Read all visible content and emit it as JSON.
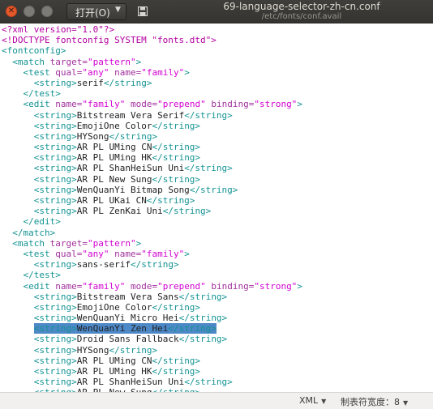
{
  "window": {
    "title": "69-language-selector-zh-cn.conf",
    "subtitle": "/etc/fonts/conf.avail",
    "open_label": "打开(O)",
    "close_icon": "close-icon",
    "minimize_icon": "minimize-icon",
    "maximize_icon": "maximize-icon",
    "save_icon": "save-icon"
  },
  "colors": {
    "tag": "#159393",
    "attr_name": "#a0309c",
    "attr_value": "#d100d1",
    "selection": "#4d88c7",
    "close_button": "#e5592b"
  },
  "editor": {
    "selected_line": 28,
    "lines": [
      [
        [
          "pi",
          "<?xml version=\"1.0\"?>"
        ]
      ],
      [
        [
          "pi",
          "<!DOCTYPE fontconfig SYSTEM \"fonts.dtd\">"
        ]
      ],
      [
        [
          "t",
          "<fontconfig>"
        ]
      ],
      [
        [
          "p",
          "  "
        ],
        [
          "t",
          "<match "
        ],
        [
          "a",
          "target="
        ],
        [
          "v",
          "\"pattern\""
        ],
        [
          "t",
          ">"
        ]
      ],
      [
        [
          "p",
          "    "
        ],
        [
          "t",
          "<test "
        ],
        [
          "a",
          "qual="
        ],
        [
          "v",
          "\"any\""
        ],
        [
          "p",
          " "
        ],
        [
          "a",
          "name="
        ],
        [
          "v",
          "\"family\""
        ],
        [
          "t",
          ">"
        ]
      ],
      [
        [
          "p",
          "      "
        ],
        [
          "t",
          "<string>"
        ],
        [
          "p",
          "serif"
        ],
        [
          "t",
          "</string>"
        ]
      ],
      [
        [
          "p",
          "    "
        ],
        [
          "t",
          "</test>"
        ]
      ],
      [
        [
          "p",
          "    "
        ],
        [
          "t",
          "<edit "
        ],
        [
          "a",
          "name="
        ],
        [
          "v",
          "\"family\""
        ],
        [
          "p",
          " "
        ],
        [
          "a",
          "mode="
        ],
        [
          "v",
          "\"prepend\""
        ],
        [
          "p",
          " "
        ],
        [
          "a",
          "binding="
        ],
        [
          "v",
          "\"strong\""
        ],
        [
          "t",
          ">"
        ]
      ],
      [
        [
          "p",
          "      "
        ],
        [
          "t",
          "<string>"
        ],
        [
          "p",
          "Bitstream Vera Serif"
        ],
        [
          "t",
          "</string>"
        ]
      ],
      [
        [
          "p",
          "      "
        ],
        [
          "t",
          "<string>"
        ],
        [
          "p",
          "EmojiOne Color"
        ],
        [
          "t",
          "</string>"
        ]
      ],
      [
        [
          "p",
          "      "
        ],
        [
          "t",
          "<string>"
        ],
        [
          "p",
          "HYSong"
        ],
        [
          "t",
          "</string>"
        ]
      ],
      [
        [
          "p",
          "      "
        ],
        [
          "t",
          "<string>"
        ],
        [
          "p",
          "AR PL UMing CN"
        ],
        [
          "t",
          "</string>"
        ]
      ],
      [
        [
          "p",
          "      "
        ],
        [
          "t",
          "<string>"
        ],
        [
          "p",
          "AR PL UMing HK"
        ],
        [
          "t",
          "</string>"
        ]
      ],
      [
        [
          "p",
          "      "
        ],
        [
          "t",
          "<string>"
        ],
        [
          "p",
          "AR PL ShanHeiSun Uni"
        ],
        [
          "t",
          "</string>"
        ]
      ],
      [
        [
          "p",
          "      "
        ],
        [
          "t",
          "<string>"
        ],
        [
          "p",
          "AR PL New Sung"
        ],
        [
          "t",
          "</string>"
        ]
      ],
      [
        [
          "p",
          "      "
        ],
        [
          "t",
          "<string>"
        ],
        [
          "p",
          "WenQuanYi Bitmap Song"
        ],
        [
          "t",
          "</string>"
        ]
      ],
      [
        [
          "p",
          "      "
        ],
        [
          "t",
          "<string>"
        ],
        [
          "p",
          "AR PL UKai CN"
        ],
        [
          "t",
          "</string>"
        ]
      ],
      [
        [
          "p",
          "      "
        ],
        [
          "t",
          "<string>"
        ],
        [
          "p",
          "AR PL ZenKai Uni"
        ],
        [
          "t",
          "</string>"
        ]
      ],
      [
        [
          "p",
          "    "
        ],
        [
          "t",
          "</edit>"
        ]
      ],
      [
        [
          "p",
          "  "
        ],
        [
          "t",
          "</match>"
        ]
      ],
      [
        [
          "p",
          "  "
        ],
        [
          "t",
          "<match "
        ],
        [
          "a",
          "target="
        ],
        [
          "v",
          "\"pattern\""
        ],
        [
          "t",
          ">"
        ]
      ],
      [
        [
          "p",
          "    "
        ],
        [
          "t",
          "<test "
        ],
        [
          "a",
          "qual="
        ],
        [
          "v",
          "\"any\""
        ],
        [
          "p",
          " "
        ],
        [
          "a",
          "name="
        ],
        [
          "v",
          "\"family\""
        ],
        [
          "t",
          ">"
        ]
      ],
      [
        [
          "p",
          "      "
        ],
        [
          "t",
          "<string>"
        ],
        [
          "p",
          "sans-serif"
        ],
        [
          "t",
          "</string>"
        ]
      ],
      [
        [
          "p",
          "    "
        ],
        [
          "t",
          "</test>"
        ]
      ],
      [
        [
          "p",
          "    "
        ],
        [
          "t",
          "<edit "
        ],
        [
          "a",
          "name="
        ],
        [
          "v",
          "\"family\""
        ],
        [
          "p",
          " "
        ],
        [
          "a",
          "mode="
        ],
        [
          "v",
          "\"prepend\""
        ],
        [
          "p",
          " "
        ],
        [
          "a",
          "binding="
        ],
        [
          "v",
          "\"strong\""
        ],
        [
          "t",
          ">"
        ]
      ],
      [
        [
          "p",
          "      "
        ],
        [
          "t",
          "<string>"
        ],
        [
          "p",
          "Bitstream Vera Sans"
        ],
        [
          "t",
          "</string>"
        ]
      ],
      [
        [
          "p",
          "      "
        ],
        [
          "t",
          "<string>"
        ],
        [
          "p",
          "EmojiOne Color"
        ],
        [
          "t",
          "</string>"
        ]
      ],
      [
        [
          "p",
          "      "
        ],
        [
          "t",
          "<string>"
        ],
        [
          "p",
          "WenQuanYi Micro Hei"
        ],
        [
          "t",
          "</string>"
        ]
      ],
      [
        [
          "p",
          "      "
        ],
        [
          "t",
          "<string>"
        ],
        [
          "p",
          "WenQuanYi Zen Hei"
        ],
        [
          "t",
          "</string>"
        ]
      ],
      [
        [
          "p",
          "      "
        ],
        [
          "t",
          "<string>"
        ],
        [
          "p",
          "Droid Sans Fallback"
        ],
        [
          "t",
          "</string>"
        ]
      ],
      [
        [
          "p",
          "      "
        ],
        [
          "t",
          "<string>"
        ],
        [
          "p",
          "HYSong"
        ],
        [
          "t",
          "</string>"
        ]
      ],
      [
        [
          "p",
          "      "
        ],
        [
          "t",
          "<string>"
        ],
        [
          "p",
          "AR PL UMing CN"
        ],
        [
          "t",
          "</string>"
        ]
      ],
      [
        [
          "p",
          "      "
        ],
        [
          "t",
          "<string>"
        ],
        [
          "p",
          "AR PL UMing HK"
        ],
        [
          "t",
          "</string>"
        ]
      ],
      [
        [
          "p",
          "      "
        ],
        [
          "t",
          "<string>"
        ],
        [
          "p",
          "AR PL ShanHeiSun Uni"
        ],
        [
          "t",
          "</string>"
        ]
      ],
      [
        [
          "p",
          "      "
        ],
        [
          "t",
          "<string>"
        ],
        [
          "p",
          "AR PL New Sung"
        ],
        [
          "t",
          "</string>"
        ]
      ]
    ]
  },
  "statusbar": {
    "language": "XML",
    "tab_width": "制表符宽度：8"
  }
}
